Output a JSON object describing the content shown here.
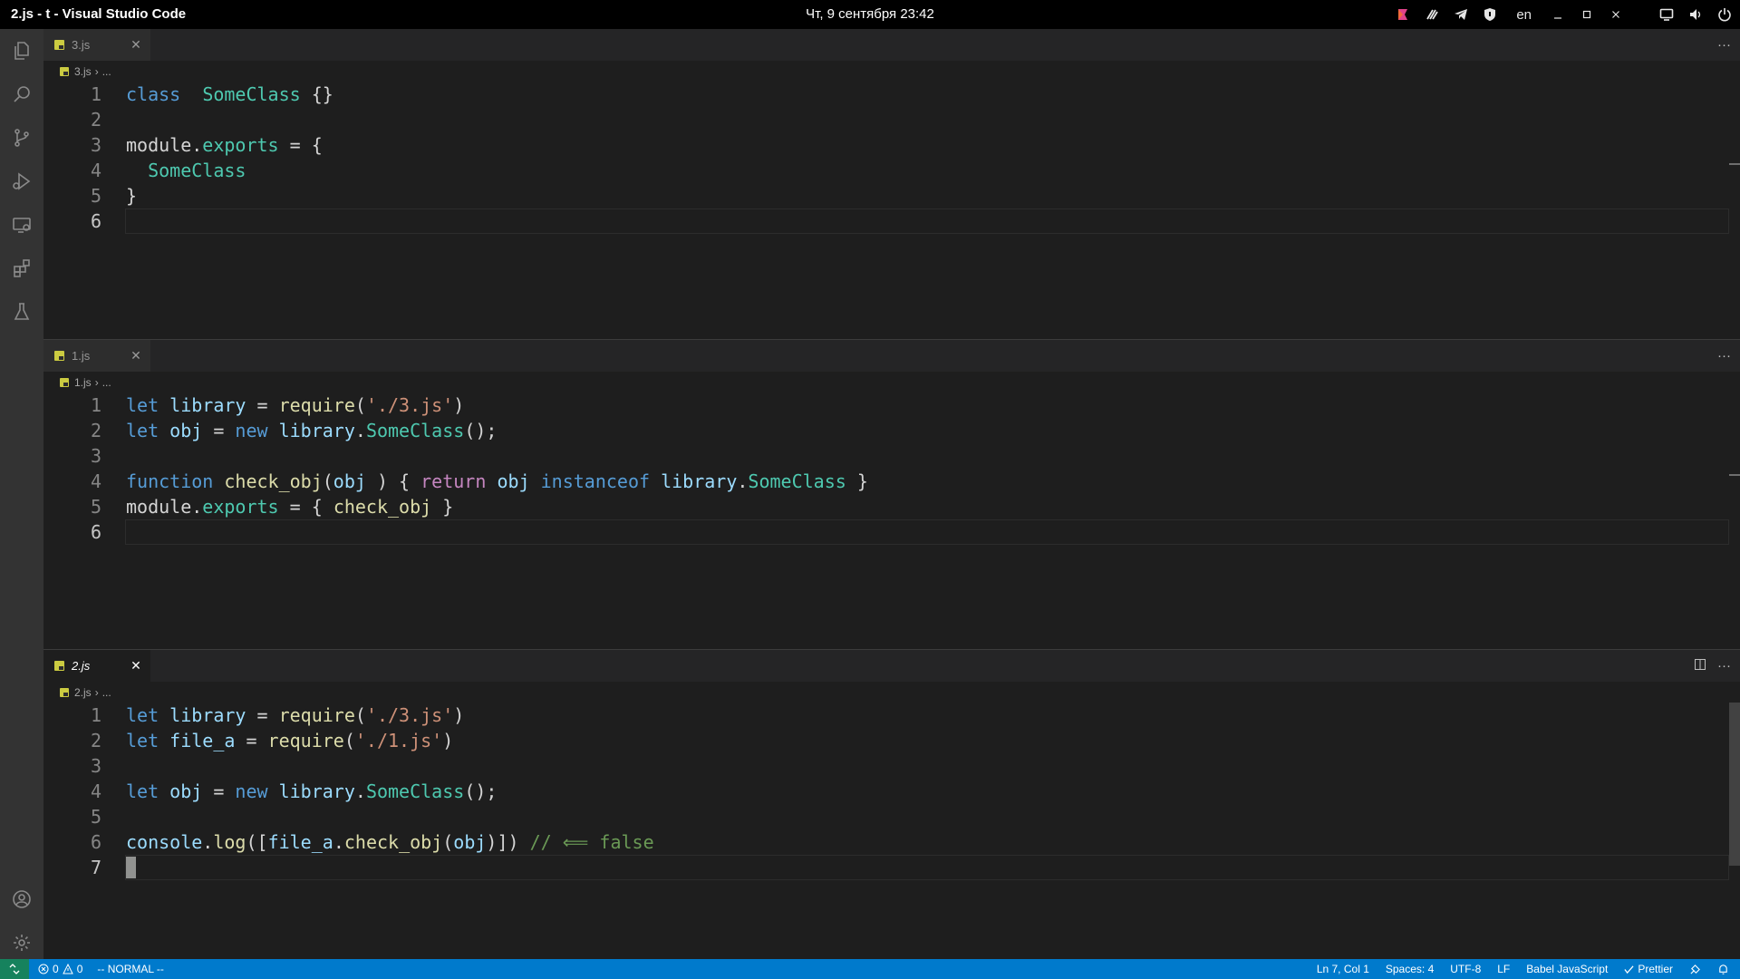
{
  "window": {
    "title": "2.js - t - Visual Studio Code",
    "clock": "Чт, 9 сентября  23:42",
    "lang": "en"
  },
  "tray_icons": [
    "app-icon",
    "brush-icon",
    "telegram-icon",
    "shield-icon"
  ],
  "activity_bar": {
    "top": [
      "explorer-icon",
      "search-icon",
      "source-control-icon",
      "run-debug-icon",
      "remote-explorer-icon",
      "extensions-icon",
      "testing-icon"
    ],
    "bottom": [
      "accounts-icon",
      "settings-gear-icon"
    ]
  },
  "groups": [
    {
      "tab": "3.js",
      "breadcrumb": [
        "3.js",
        "..."
      ],
      "active": false,
      "lines": [
        {
          "n": "1",
          "tokens": [
            [
              "kw",
              "class"
            ],
            [
              "",
              "  "
            ],
            [
              "cls",
              "SomeClass"
            ],
            [
              "",
              " {}"
            ]
          ]
        },
        {
          "n": "2",
          "tokens": []
        },
        {
          "n": "3",
          "tokens": [
            [
              "",
              "module."
            ],
            [
              "cls",
              "exports"
            ],
            [
              "",
              " = {"
            ]
          ]
        },
        {
          "n": "4",
          "tokens": [
            [
              "",
              "  "
            ],
            [
              "cls",
              "SomeClass"
            ]
          ]
        },
        {
          "n": "5",
          "tokens": [
            [
              "",
              "}"
            ]
          ]
        },
        {
          "n": "6",
          "tokens": [],
          "current": true
        }
      ]
    },
    {
      "tab": "1.js",
      "breadcrumb": [
        "1.js",
        "..."
      ],
      "active": false,
      "lines": [
        {
          "n": "1",
          "tokens": [
            [
              "kw",
              "let"
            ],
            [
              "",
              " "
            ],
            [
              "var",
              "library"
            ],
            [
              "",
              " = "
            ],
            [
              "fn",
              "require"
            ],
            [
              "",
              "("
            ],
            [
              "str",
              "'./3.js'"
            ],
            [
              "",
              ")"
            ]
          ]
        },
        {
          "n": "2",
          "tokens": [
            [
              "kw",
              "let"
            ],
            [
              "",
              " "
            ],
            [
              "var",
              "obj"
            ],
            [
              "",
              " = "
            ],
            [
              "kw",
              "new"
            ],
            [
              "",
              " "
            ],
            [
              "var",
              "library"
            ],
            [
              "",
              "."
            ],
            [
              "cls",
              "SomeClass"
            ],
            [
              "",
              "();"
            ]
          ]
        },
        {
          "n": "3",
          "tokens": []
        },
        {
          "n": "4",
          "tokens": [
            [
              "kw",
              "function"
            ],
            [
              "",
              " "
            ],
            [
              "fn",
              "check_obj"
            ],
            [
              "",
              "("
            ],
            [
              "var",
              "obj"
            ],
            [
              "",
              " ) { "
            ],
            [
              "ctrl",
              "return"
            ],
            [
              "",
              " "
            ],
            [
              "var",
              "obj"
            ],
            [
              "",
              " "
            ],
            [
              "kw",
              "instanceof"
            ],
            [
              "",
              " "
            ],
            [
              "var",
              "library"
            ],
            [
              "",
              "."
            ],
            [
              "cls",
              "SomeClass"
            ],
            [
              "",
              " }"
            ]
          ]
        },
        {
          "n": "5",
          "tokens": [
            [
              "",
              "module."
            ],
            [
              "cls",
              "exports"
            ],
            [
              "",
              " = { "
            ],
            [
              "fn",
              "check_obj"
            ],
            [
              "",
              " }"
            ]
          ]
        },
        {
          "n": "6",
          "tokens": [],
          "current": true
        }
      ]
    },
    {
      "tab": "2.js",
      "breadcrumb": [
        "2.js",
        "..."
      ],
      "active": true,
      "lines": [
        {
          "n": "1",
          "tokens": [
            [
              "kw",
              "let"
            ],
            [
              "",
              " "
            ],
            [
              "var",
              "library"
            ],
            [
              "",
              " = "
            ],
            [
              "fn",
              "require"
            ],
            [
              "",
              "("
            ],
            [
              "str",
              "'./3.js'"
            ],
            [
              "",
              ")"
            ]
          ]
        },
        {
          "n": "2",
          "tokens": [
            [
              "kw",
              "let"
            ],
            [
              "",
              " "
            ],
            [
              "var",
              "file_a"
            ],
            [
              "",
              " = "
            ],
            [
              "fn",
              "require"
            ],
            [
              "",
              "("
            ],
            [
              "str",
              "'./1.js'"
            ],
            [
              "",
              ")"
            ]
          ]
        },
        {
          "n": "3",
          "tokens": []
        },
        {
          "n": "4",
          "tokens": [
            [
              "kw",
              "let"
            ],
            [
              "",
              " "
            ],
            [
              "var",
              "obj"
            ],
            [
              "",
              " = "
            ],
            [
              "kw",
              "new"
            ],
            [
              "",
              " "
            ],
            [
              "var",
              "library"
            ],
            [
              "",
              "."
            ],
            [
              "cls",
              "SomeClass"
            ],
            [
              "",
              "();"
            ]
          ]
        },
        {
          "n": "5",
          "tokens": []
        },
        {
          "n": "6",
          "tokens": [
            [
              "var",
              "console"
            ],
            [
              "",
              "."
            ],
            [
              "fn",
              "log"
            ],
            [
              "",
              "(["
            ],
            [
              "var",
              "file_a"
            ],
            [
              "",
              "."
            ],
            [
              "fn",
              "check_obj"
            ],
            [
              "",
              "("
            ],
            [
              "var",
              "obj"
            ],
            [
              "",
              ")])"
            ],
            [
              "",
              " "
            ],
            [
              "cmt",
              "// ⟸ false"
            ]
          ]
        },
        {
          "n": "7",
          "tokens": [],
          "current": true,
          "cursor": true
        }
      ]
    }
  ],
  "status": {
    "errors": "0",
    "warnings": "0",
    "mode": "-- NORMAL --",
    "position": "Ln 7, Col 1",
    "spaces": "Spaces: 4",
    "encoding": "UTF-8",
    "eol": "LF",
    "language": "Babel JavaScript",
    "formatter": "Prettier"
  },
  "colors": {
    "status_bar": "#007acc",
    "remote": "#16825d",
    "activity_bar": "#333333",
    "editor_bg": "#1e1e1e"
  }
}
